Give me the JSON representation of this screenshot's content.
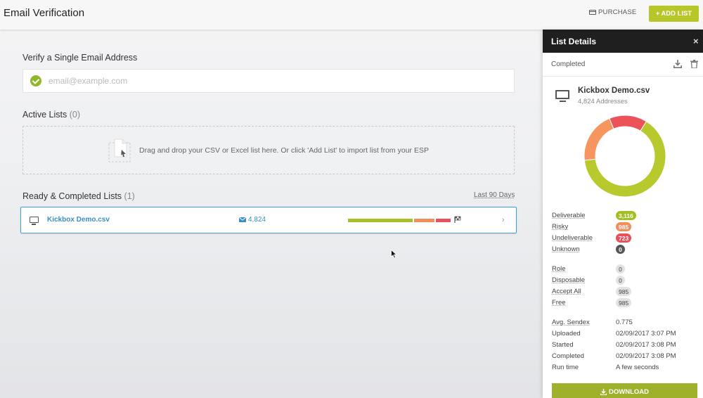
{
  "header": {
    "title": "Email Verification",
    "purchase_label": "PURCHASE",
    "add_list_label": "ADD LIST"
  },
  "verify": {
    "heading": "Verify a Single Email Address",
    "placeholder": "email@example.com",
    "value": ""
  },
  "active_lists": {
    "heading": "Active Lists",
    "count": "(0)",
    "drop_text": "Drag and drop your CSV or Excel list here. Or click 'Add List' to import list from your ESP"
  },
  "completed_lists": {
    "heading": "Ready & Completed Lists",
    "count": "(1)",
    "filter": "Last 90 Days",
    "rows": [
      {
        "name": "Kickbox Demo.csv",
        "addresses": "4,824",
        "segments": [
          {
            "value": 3116,
            "color": "#a6c02a"
          },
          {
            "value": 985,
            "color": "#f28e5c"
          },
          {
            "value": 723,
            "color": "#e8505b"
          }
        ]
      }
    ]
  },
  "panel": {
    "title": "List Details",
    "close": "×",
    "status": "Completed",
    "file_name": "Kickbox Demo.csv",
    "file_addresses": "4,824 Addresses",
    "donut": [
      {
        "label": "Deliverable",
        "value": 3116,
        "color": "#b7c92c"
      },
      {
        "label": "Risky",
        "value": 985,
        "color": "#f6955e"
      },
      {
        "label": "Undeliverable",
        "value": 723,
        "color": "#eb5359"
      },
      {
        "label": "Unknown",
        "value": 0,
        "color": "#555555"
      }
    ],
    "results": [
      {
        "label": "Deliverable",
        "badge": "3,116",
        "color": "#a3bf22"
      },
      {
        "label": "Risky",
        "badge": "985",
        "color": "#f28e5c"
      },
      {
        "label": "Undeliverable",
        "badge": "723",
        "color": "#e8505b"
      },
      {
        "label": "Unknown",
        "badge": "0",
        "color": "#555555"
      }
    ],
    "attributes": [
      {
        "label": "Role",
        "badge": "0"
      },
      {
        "label": "Disposable",
        "badge": "0"
      },
      {
        "label": "Accept All",
        "badge": "985"
      },
      {
        "label": "Free",
        "badge": "985"
      }
    ],
    "meta": [
      {
        "label": "Avg. Sendex",
        "value": "0.775"
      },
      {
        "label": "Uploaded",
        "value": "02/09/2017 3:07 PM"
      },
      {
        "label": "Started",
        "value": "02/09/2017 3:08 PM"
      },
      {
        "label": "Completed",
        "value": "02/09/2017 3:08 PM"
      },
      {
        "label": "Run time",
        "value": "A few seconds"
      }
    ],
    "download_label": "DOWNLOAD"
  }
}
